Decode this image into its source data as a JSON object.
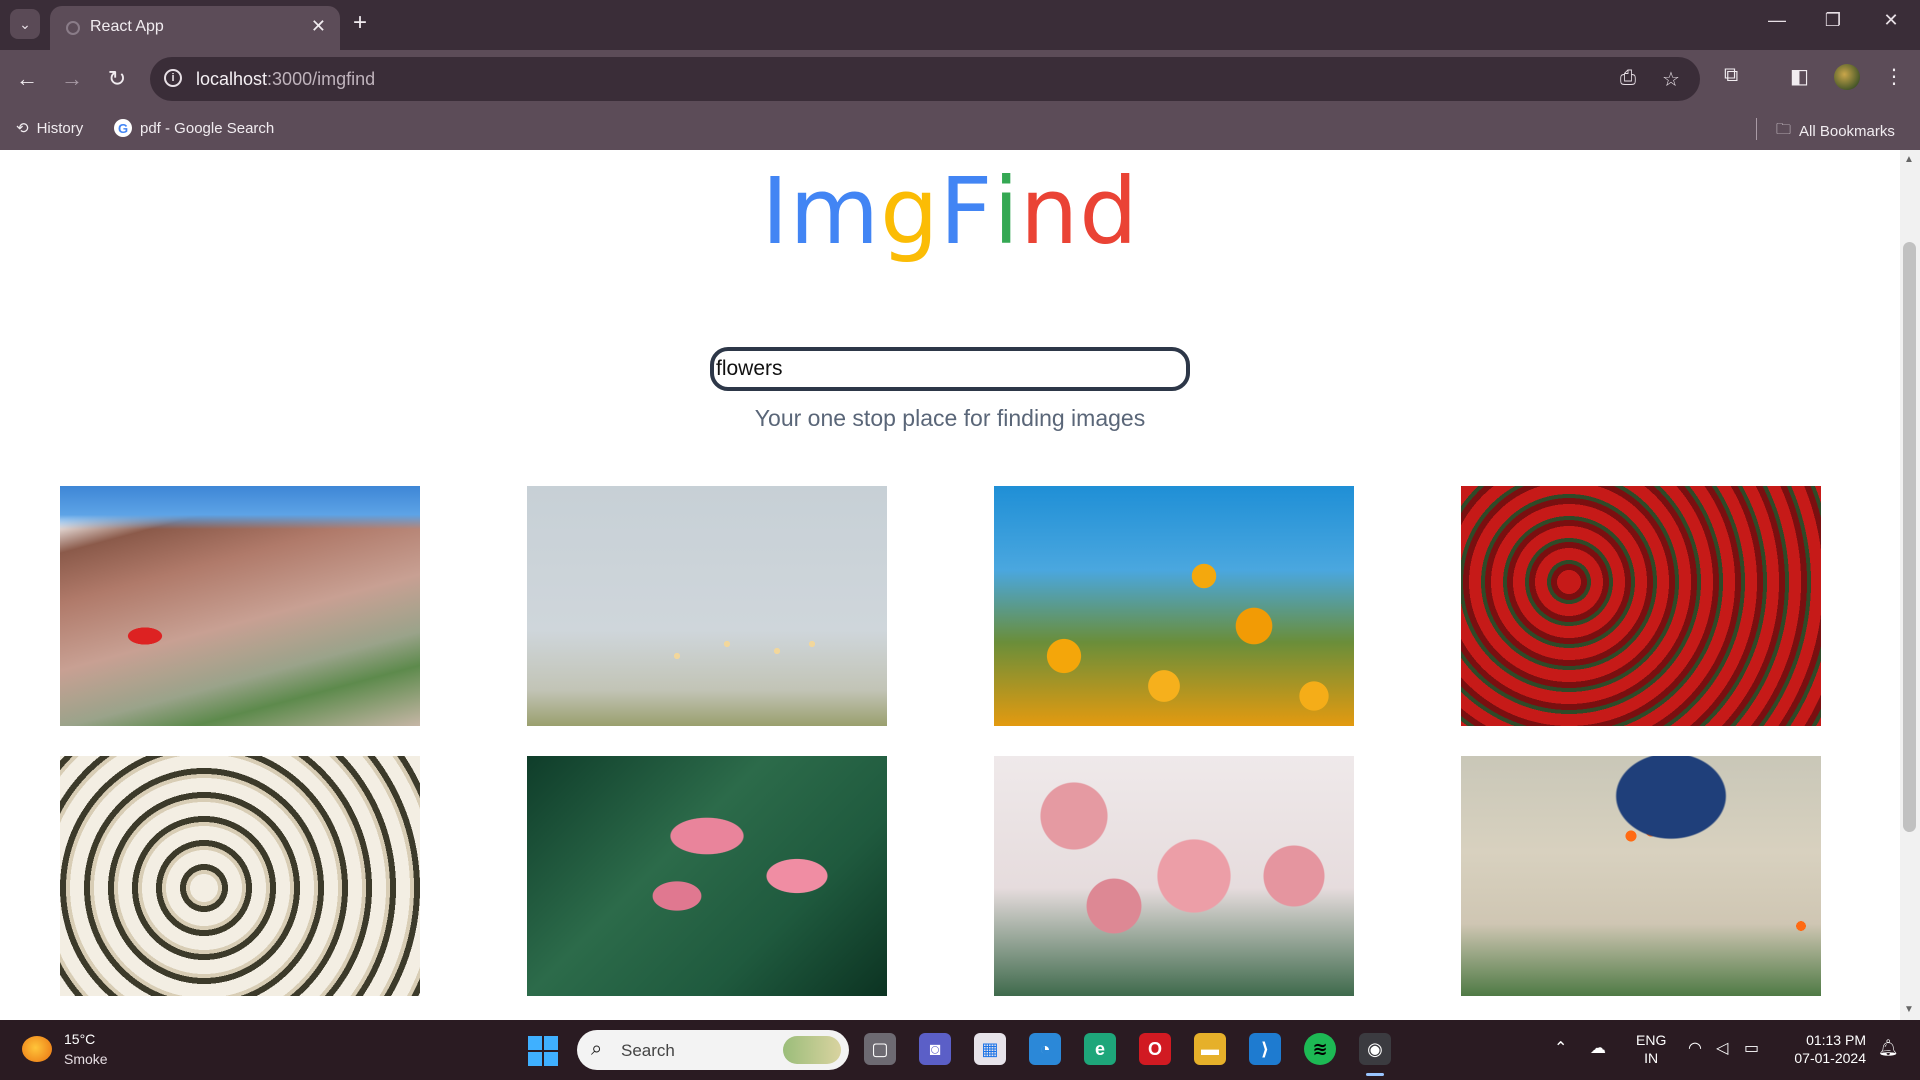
{
  "browser": {
    "tab_title": "React App",
    "new_tab_icon": "+",
    "url_host": "localhost",
    "url_path": ":3000/imgfind",
    "bookmarks": [
      {
        "label": "History",
        "icon": "history-icon"
      },
      {
        "label": "pdf - Google Search",
        "icon": "google-icon"
      }
    ],
    "all_bookmarks_label": "All Bookmarks"
  },
  "app": {
    "logo_letters": [
      "I",
      "m",
      "g",
      "F",
      "i",
      "n",
      "d"
    ],
    "logo_colors": [
      "#4285f4",
      "#4285f4",
      "#fbbc05",
      "#4285f4",
      "#34a853",
      "#ea4335",
      "#ea4335"
    ],
    "search_value": "flowers",
    "tagline": "Your one stop place for finding images",
    "images": [
      {
        "subject": "desert rocks with red poppy"
      },
      {
        "subject": "pale sky with small white flowers"
      },
      {
        "subject": "orange poppies against blue sky"
      },
      {
        "subject": "field of red roses"
      },
      {
        "subject": "white chrysanthemums"
      },
      {
        "subject": "pink calla lilies"
      },
      {
        "subject": "pink roses bouquet"
      },
      {
        "subject": "person crouching by orange flowers"
      }
    ]
  },
  "taskbar": {
    "weather_temp": "15°C",
    "weather_desc": "Smoke",
    "search_label": "Search",
    "lang_line1": "ENG",
    "lang_line2": "IN",
    "time": "01:13 PM",
    "date": "07-01-2024"
  }
}
